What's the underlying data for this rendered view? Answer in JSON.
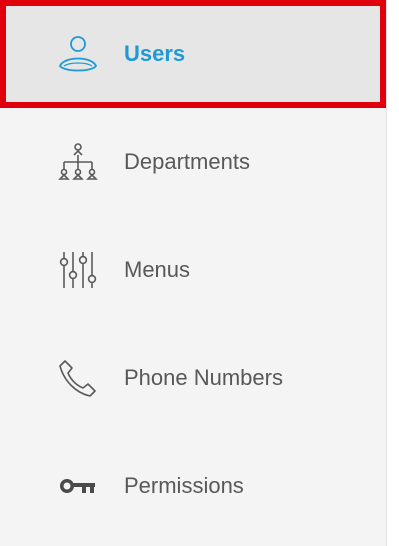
{
  "colors": {
    "sidebar_bg": "#f4f4f4",
    "active_bg": "#e6e6e6",
    "highlight_border": "#e0000b",
    "active_text": "#1d9ad6",
    "text": "#585858"
  },
  "sidebar": {
    "active_index": 0,
    "items": [
      {
        "label": "Users",
        "icon": "user-icon"
      },
      {
        "label": "Departments",
        "icon": "org-chart-icon"
      },
      {
        "label": "Menus",
        "icon": "sliders-icon"
      },
      {
        "label": "Phone Numbers",
        "icon": "phone-icon"
      },
      {
        "label": "Permissions",
        "icon": "key-icon"
      }
    ]
  }
}
